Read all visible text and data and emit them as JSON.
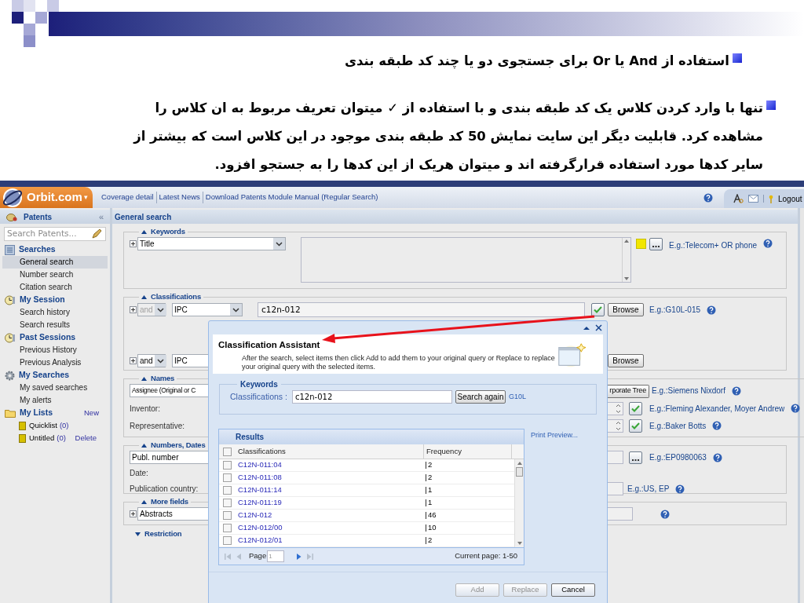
{
  "slide": {
    "bullets": [
      {
        "text": "استفاده از And یا Or برای جستجوی دو یا چند کد طبقه بندی"
      },
      {
        "text": "تنها با وارد کردن کلاس یک کد طبقه بندی و با استفاده از ✓ میتوان تعریف مربوط به ان کلاس را مشاهده کرد. قابلیت دیگر این سایت نمایش 50 کد طبقه بندی موجود در این کلاس است که بیشتر از سایر کدها مورد استفاده قرارگرفته اند و میتوان هریک از این کدها را به جستجو افزود."
      }
    ]
  },
  "app": {
    "header": {
      "brand": "Orbit.com",
      "brand_caret": "▾",
      "links": [
        "Coverage detail",
        "Latest News",
        "Download Patents Module Manual (Regular Search)"
      ],
      "logout": "Logout"
    },
    "sidebar": {
      "title": "Patents",
      "collapse": "«",
      "search_placeholder": "Search Patents...",
      "sections": [
        {
          "title": "Searches",
          "kind": "grid",
          "items": [
            {
              "label": "General search",
              "selected": true
            },
            {
              "label": "Number search",
              "selected": false
            },
            {
              "label": "Citation search",
              "selected": false
            }
          ]
        },
        {
          "title": "My Session",
          "kind": "clock",
          "items": [
            {
              "label": "Search history",
              "selected": false
            },
            {
              "label": "Search results",
              "selected": false
            }
          ]
        },
        {
          "title": "Past Sessions",
          "kind": "clock",
          "items": [
            {
              "label": "Previous History",
              "selected": false
            },
            {
              "label": "Previous Analysis",
              "selected": false
            }
          ]
        },
        {
          "title": "My Searches",
          "kind": "gear",
          "items": [
            {
              "label": "My saved searches",
              "selected": false
            },
            {
              "label": "My alerts",
              "selected": false
            }
          ]
        },
        {
          "title": "My Lists",
          "kind": "folder",
          "action": "New",
          "lists": [
            {
              "name": "Quicklist",
              "count": "(0)"
            },
            {
              "name": "Untitled",
              "count": "(0)",
              "action": "Delete"
            }
          ]
        }
      ]
    },
    "main": {
      "title": "General search",
      "keywords": {
        "legend": "Keywords",
        "expanded": true,
        "field": "Title",
        "hint": "E.g.:Telecom+ OR phone"
      },
      "classifications": {
        "legend": "Classifications",
        "expanded": true,
        "rows": [
          {
            "operator": "and",
            "operator_disabled": true,
            "scheme": "IPC",
            "value": "c12n-012",
            "browse": "Browse",
            "hint": "E.g.:G10L-015"
          },
          {
            "operator": "and",
            "operator_disabled": false,
            "scheme": "IPC",
            "browse": "Browse"
          }
        ]
      },
      "names": {
        "legend": "Names",
        "expanded": true,
        "field": "Assignee (Original or C",
        "tree_button": "rporate Tree",
        "hint": "E.g.:Siemens Nixdorf",
        "rows": [
          {
            "label": "Inventor:",
            "hint": "E.g.:Fleming Alexander, Moyer Andrew"
          },
          {
            "label": "Representative:",
            "hint": "E.g.:Baker Botts"
          }
        ]
      },
      "numbers": {
        "legend": "Numbers, Dates",
        "expanded": true,
        "field": "Publ. number",
        "hint": "E.g.:EP0980063",
        "date_label": "Date:",
        "country_label": "Publication country:",
        "country_hint": "E.g.:US, EP"
      },
      "more_fields": {
        "legend": "More fields",
        "expanded": true,
        "field": "Abstracts"
      },
      "restriction": {
        "legend": "Restriction",
        "expanded": false
      }
    },
    "dialog": {
      "title": "Classification Assistant",
      "description": "After the search, select items then click Add to add them to your original query or Replace to replace your original query with the selected items.",
      "keywords_legend": "Keywords",
      "field_label": "Classifications :",
      "field_value": "c12n-012",
      "search_button": "Search again",
      "suggestion": "G10L",
      "results_title": "Results",
      "print_preview": "Print Preview...",
      "columns": [
        "Classifications",
        "Frequency"
      ],
      "all_checked": false,
      "rows": [
        {
          "code": "C12N-011:04",
          "frequency": "2",
          "checked": false
        },
        {
          "code": "C12N-011:08",
          "frequency": "2",
          "checked": false
        },
        {
          "code": "C12N-011:14",
          "frequency": "1",
          "checked": false
        },
        {
          "code": "C12N-011:19",
          "frequency": "1",
          "checked": false
        },
        {
          "code": "C12N-012",
          "frequency": "46",
          "checked": false
        },
        {
          "code": "C12N-012/00",
          "frequency": "10",
          "checked": false
        },
        {
          "code": "C12N-012/01",
          "frequency": "2",
          "checked": false
        }
      ],
      "page_label": "Page",
      "page_value": "1",
      "current_page": "Current page: 1-50",
      "buttons": [
        {
          "label": "Add",
          "disabled": true
        },
        {
          "label": "Replace",
          "disabled": true
        },
        {
          "label": "Cancel",
          "disabled": false
        }
      ]
    }
  }
}
